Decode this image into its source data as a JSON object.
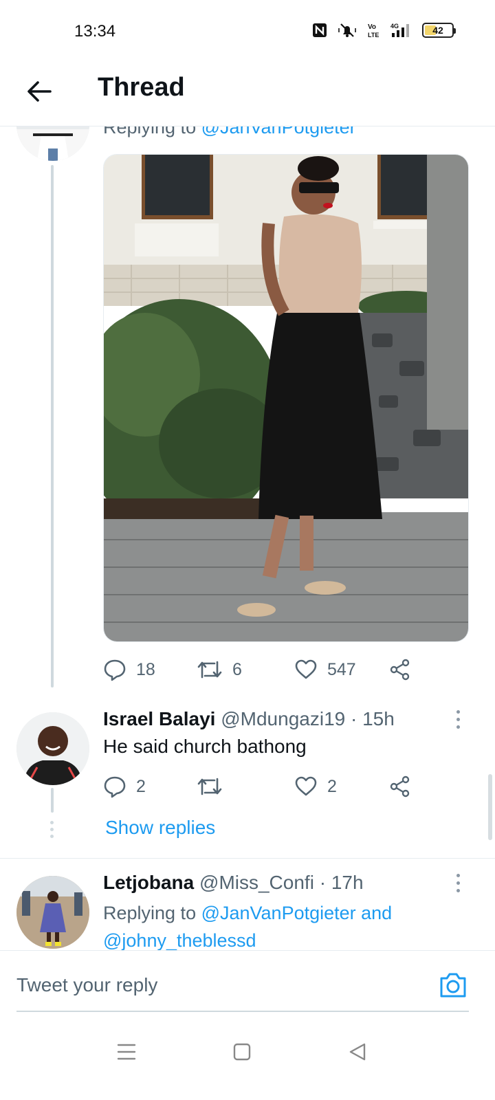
{
  "status_bar": {
    "time": "13:34",
    "battery_level": 42,
    "network_label": "4G",
    "volte_label": "Vo LTE",
    "icons": [
      "nfc-icon",
      "mute-icon",
      "volte-icon",
      "signal-icon",
      "battery-icon"
    ]
  },
  "header": {
    "title": "Thread",
    "back_icon": "arrow-left-icon"
  },
  "thread": {
    "main_tweet": {
      "replying_label": "Replying to ",
      "replying_to": "@JanVanPotgieter",
      "media_description_icon": "photo",
      "actions": {
        "replies": "18",
        "retweets": "6",
        "likes": "547"
      }
    },
    "reply_1": {
      "name": "Israel Balayi",
      "handle": "@Mdungazi19",
      "time": "15h",
      "text": "He said church bathong",
      "actions": {
        "replies": "2",
        "retweets": "",
        "likes": "2"
      },
      "show_replies": "Show replies"
    },
    "reply_2": {
      "name": "Letjobana",
      "handle": "@Miss_Confi",
      "time": "17h",
      "replying_label": "Replying to ",
      "replying_to_1": "@JanVanPotgieter",
      "replying_and": " and",
      "replying_to_2": "@johny_theblessd"
    }
  },
  "composer": {
    "placeholder": "Tweet your reply",
    "camera_icon": "camera-icon"
  },
  "navbar": {
    "icons": [
      "menu-icon",
      "home-square-icon",
      "back-triangle-icon"
    ]
  },
  "colors": {
    "accent": "#1d9bf0",
    "secondary_text": "#536471",
    "thread_line": "#cfd9de",
    "battery_fill": "#f2d56b"
  }
}
